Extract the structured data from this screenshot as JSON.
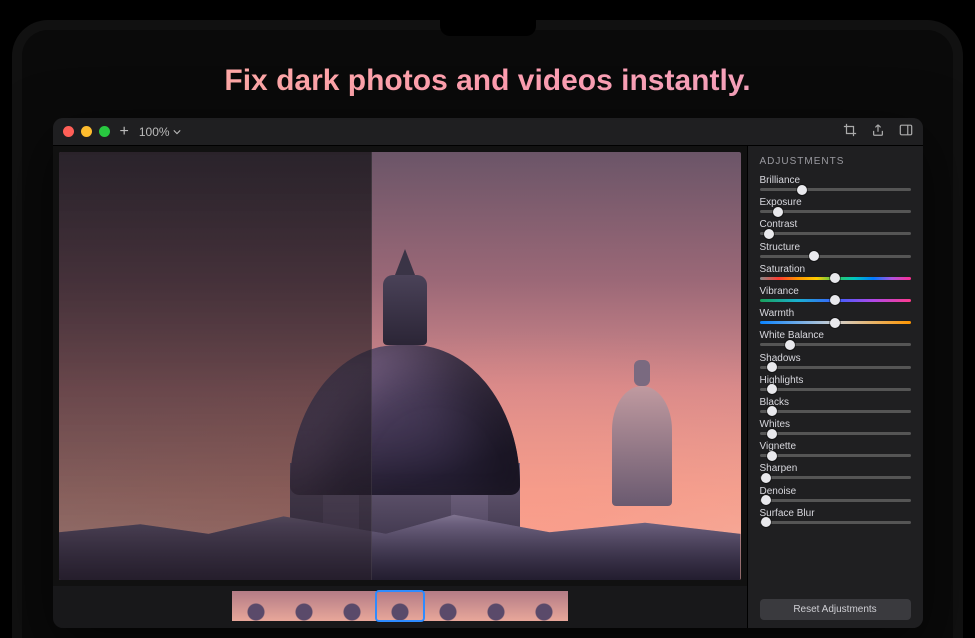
{
  "headline": "Fix dark photos and videos instantly.",
  "titlebar": {
    "zoom_label": "100%"
  },
  "inspector": {
    "title": "ADJUSTMENTS",
    "reset_label": "Reset Adjustments",
    "sliders": [
      {
        "label": "Brilliance",
        "value": 28,
        "track": "plain"
      },
      {
        "label": "Exposure",
        "value": 12,
        "track": "plain"
      },
      {
        "label": "Contrast",
        "value": 6,
        "track": "plain"
      },
      {
        "label": "Structure",
        "value": 36,
        "track": "plain"
      },
      {
        "label": "Saturation",
        "value": 50,
        "track": "sat"
      },
      {
        "label": "Vibrance",
        "value": 50,
        "track": "vib"
      },
      {
        "label": "Warmth",
        "value": 50,
        "track": "warm"
      },
      {
        "label": "White Balance",
        "value": 20,
        "track": "plain"
      },
      {
        "label": "Shadows",
        "value": 8,
        "track": "plain"
      },
      {
        "label": "Highlights",
        "value": 8,
        "track": "plain"
      },
      {
        "label": "Blacks",
        "value": 8,
        "track": "plain"
      },
      {
        "label": "Whites",
        "value": 8,
        "track": "plain"
      },
      {
        "label": "Vignette",
        "value": 8,
        "track": "plain"
      },
      {
        "label": "Sharpen",
        "value": 4,
        "track": "plain"
      },
      {
        "label": "Denoise",
        "value": 4,
        "track": "plain"
      },
      {
        "label": "Surface Blur",
        "value": 4,
        "track": "plain"
      }
    ]
  },
  "filmstrip": {
    "count": 7,
    "selected_index": 3
  }
}
